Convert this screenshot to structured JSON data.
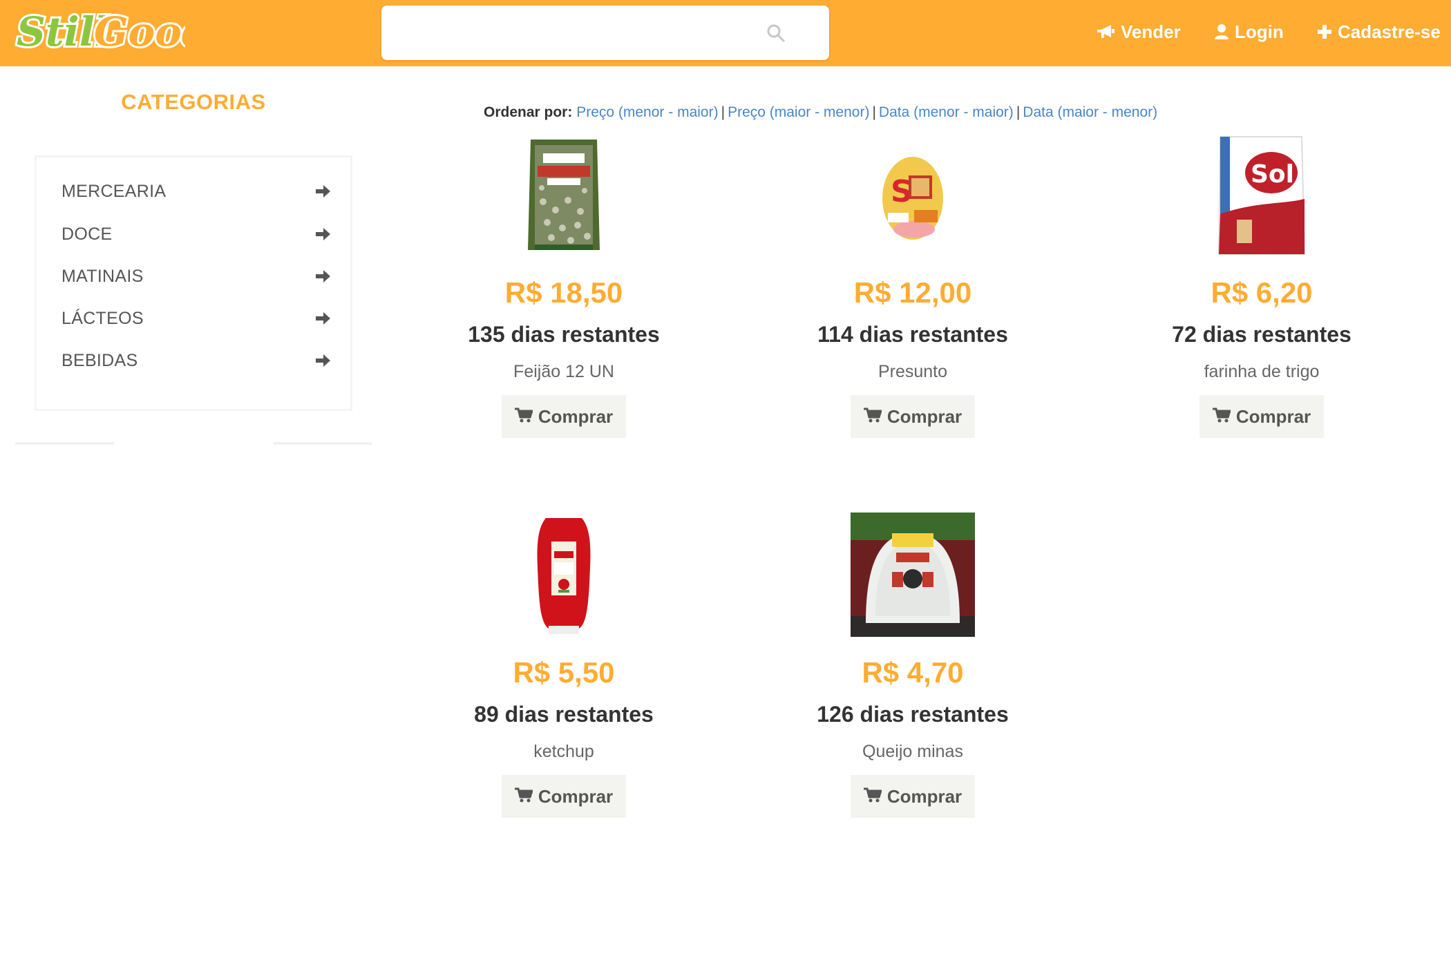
{
  "header": {
    "logo_text": "StillGood",
    "search": {
      "placeholder": "",
      "value": ""
    },
    "nav": [
      {
        "label": "Vender",
        "icon": "megaphone-icon"
      },
      {
        "label": "Login",
        "icon": "user-icon"
      },
      {
        "label": "Cadastre-se",
        "icon": "plus-icon"
      }
    ]
  },
  "sidebar": {
    "title": "CATEGORIAS",
    "items": [
      {
        "label": "MERCEARIA",
        "icon": "arrow-right-icon"
      },
      {
        "label": "DOCE",
        "icon": "arrow-right-icon"
      },
      {
        "label": "MATINAIS",
        "icon": "arrow-right-icon"
      },
      {
        "label": "LÁCTEOS",
        "icon": "arrow-right-icon"
      },
      {
        "label": "BEBIDAS",
        "icon": "arrow-right-icon"
      }
    ]
  },
  "sort": {
    "label": "Ordenar por:",
    "options": [
      "Preço (menor - maior)",
      "Preço (maior - menor)",
      "Data (menor - maior)",
      "Data (maior - menor)"
    ],
    "separator": "|"
  },
  "products": [
    {
      "price": "R$ 18,50",
      "days": "135 dias restantes",
      "name": "Feijão 12 UN",
      "button": "Comprar",
      "image": "bean-bag-image"
    },
    {
      "price": "R$ 12,00",
      "days": "114 dias restantes",
      "name": "Presunto",
      "button": "Comprar",
      "image": "ham-image"
    },
    {
      "price": "R$ 6,20",
      "days": "72 dias restantes",
      "name": "farinha de trigo",
      "button": "Comprar",
      "image": "flour-bag-image"
    },
    {
      "price": "R$ 5,50",
      "days": "89 dias restantes",
      "name": "ketchup",
      "button": "Comprar",
      "image": "ketchup-bottle-image"
    },
    {
      "price": "R$ 4,70",
      "days": "126 dias restantes",
      "name": "Queijo minas",
      "button": "Comprar",
      "image": "cheese-image"
    }
  ],
  "colors": {
    "header_bg": "#ffac33",
    "accent": "#ffac33",
    "link": "#4a86c6",
    "button_bg": "#f3f3ef"
  }
}
